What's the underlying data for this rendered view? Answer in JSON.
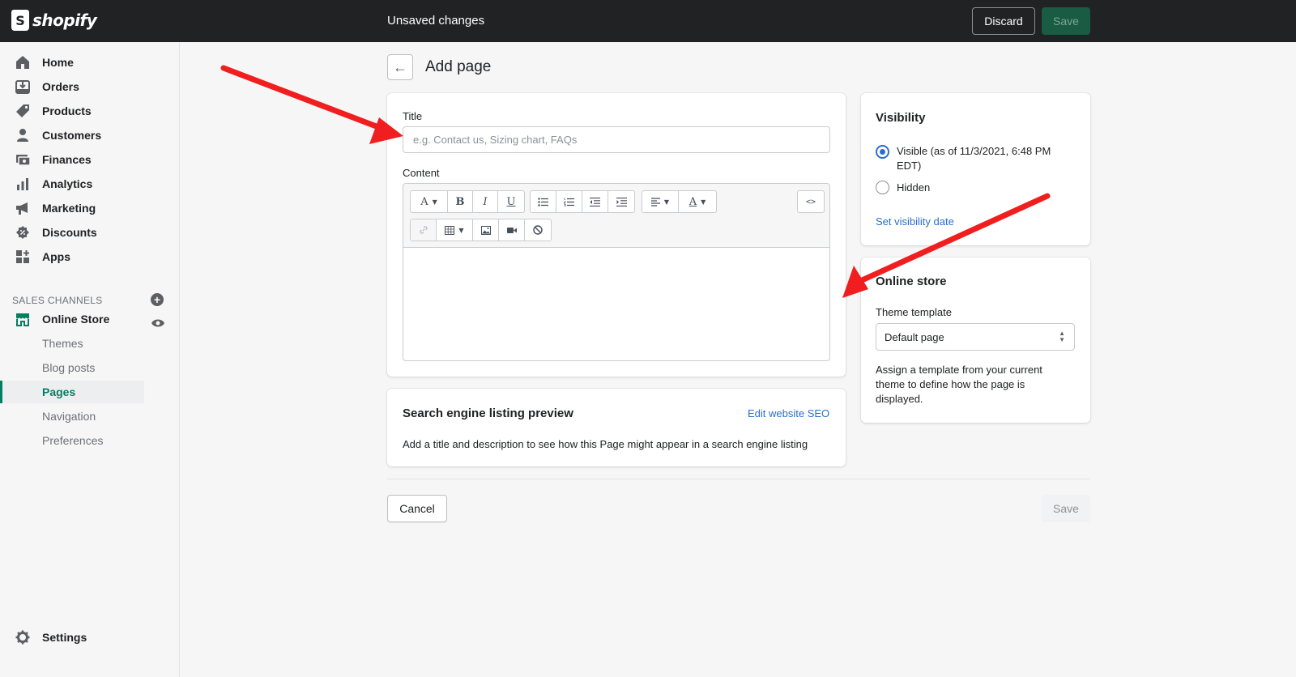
{
  "topbar": {
    "brand": "shopify",
    "status": "Unsaved changes",
    "discard_label": "Discard",
    "save_label": "Save"
  },
  "sidebar": {
    "items": [
      {
        "label": "Home",
        "icon": "home-icon"
      },
      {
        "label": "Orders",
        "icon": "orders-icon"
      },
      {
        "label": "Products",
        "icon": "tag-icon"
      },
      {
        "label": "Customers",
        "icon": "person-icon"
      },
      {
        "label": "Finances",
        "icon": "finances-icon"
      },
      {
        "label": "Analytics",
        "icon": "bar-chart-icon"
      },
      {
        "label": "Marketing",
        "icon": "megaphone-icon"
      },
      {
        "label": "Discounts",
        "icon": "discount-icon"
      },
      {
        "label": "Apps",
        "icon": "apps-icon"
      }
    ],
    "sales_channels_title": "SALES CHANNELS",
    "online_store": "Online Store",
    "sub_items": [
      "Themes",
      "Blog posts",
      "Pages",
      "Navigation",
      "Preferences"
    ],
    "active_sub_item": "Pages",
    "settings": "Settings"
  },
  "page": {
    "title": "Add page"
  },
  "form": {
    "title_label": "Title",
    "title_placeholder": "e.g. Contact us, Sizing chart, FAQs",
    "content_label": "Content"
  },
  "seo": {
    "heading": "Search engine listing preview",
    "edit_link": "Edit website SEO",
    "description": "Add a title and description to see how this Page might appear in a search engine listing"
  },
  "visibility": {
    "heading": "Visibility",
    "visible_label": "Visible (as of 11/3/2021, 6:48 PM EDT)",
    "visible_line1": "Visible (as of 11/3/2021, 6:48 PM",
    "visible_line2": "EDT)",
    "hidden_label": "Hidden",
    "selected": "visible",
    "set_date_link": "Set visibility date"
  },
  "online_store_card": {
    "heading": "Online store",
    "theme_template_label": "Theme template",
    "theme_template_value": "Default page",
    "help_line1": "Assign a template from your current",
    "help_line2": "theme to define how the page is",
    "help_line3": "displayed."
  },
  "footer": {
    "cancel_label": "Cancel",
    "save_label": "Save"
  },
  "colors": {
    "topbar": "#202223",
    "accent_green": "#008060",
    "link_blue": "#2c6ecb",
    "annotation_arrow": "#f01e1e"
  }
}
